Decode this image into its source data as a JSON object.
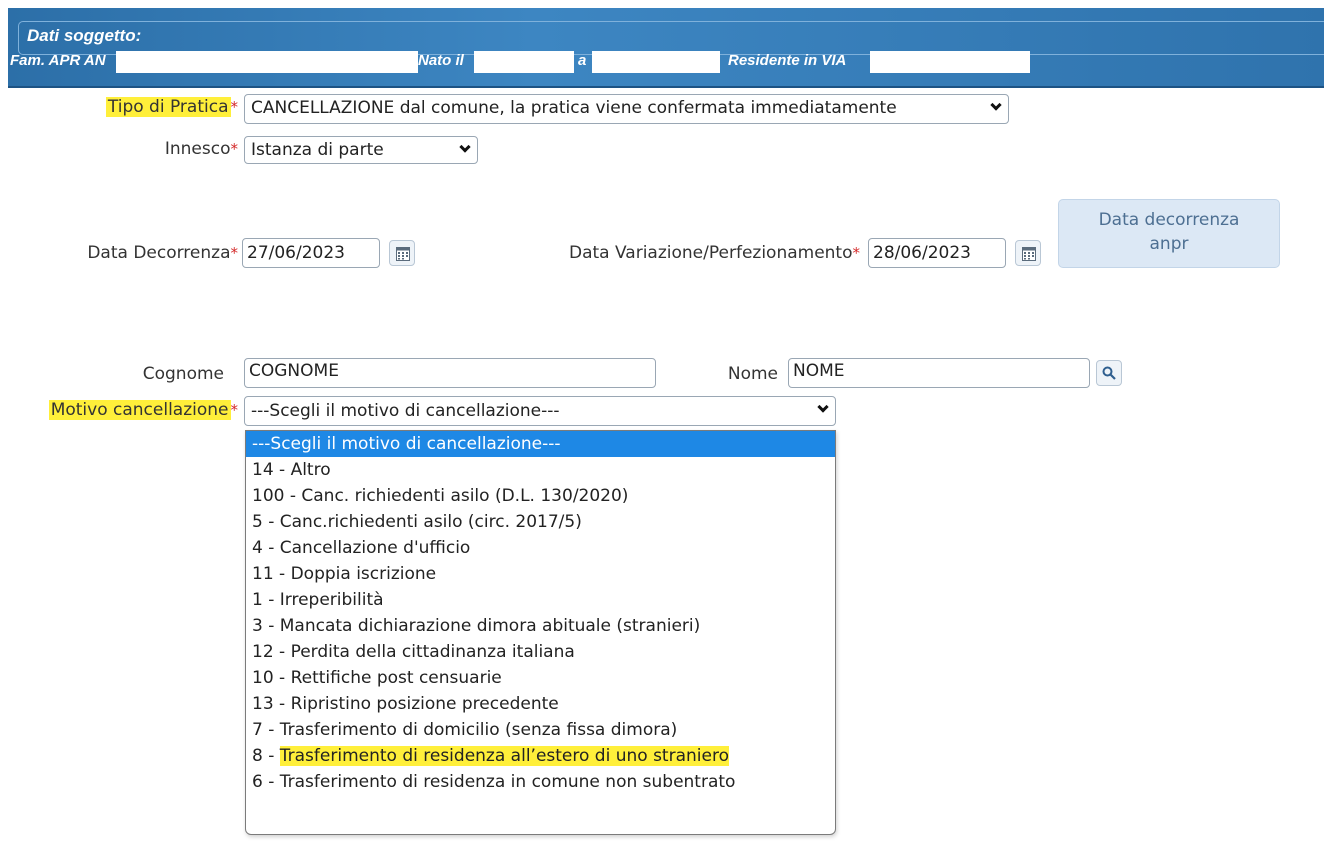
{
  "header": {
    "title": "Dati soggetto:",
    "family_label": "Fam. APR AN",
    "born_label": "Nato il",
    "at_label": "a",
    "residence_label": "Residente in VIA"
  },
  "form": {
    "tipo_pratica": {
      "label": "Tipo di Pratica",
      "required": "*",
      "value": "CANCELLAZIONE dal comune, la pratica viene confermata immediatamente"
    },
    "innesco": {
      "label": "Innesco",
      "required": "*",
      "value": "Istanza di parte"
    },
    "data_decorrenza": {
      "label": "Data Decorrenza",
      "required": "*",
      "value": "27/06/2023"
    },
    "data_variazione": {
      "label": "Data Variazione/Perfezionamento",
      "required": "*",
      "value": "28/06/2023"
    },
    "anpr_button": {
      "line1": "Data decorrenza",
      "line2": "anpr"
    },
    "cognome": {
      "label": "Cognome",
      "value": "COGNOME"
    },
    "nome": {
      "label": "Nome",
      "value": "NOME"
    },
    "motivo": {
      "label": "Motivo cancellazione",
      "required": "*",
      "value": "---Scegli il motivo di cancellazione---"
    }
  },
  "motivo_options": [
    {
      "label": "---Scegli il motivo di cancellazione---"
    },
    {
      "label": "14 - Altro"
    },
    {
      "label": "100 - Canc. richiedenti asilo (D.L. 130/2020)"
    },
    {
      "label": "5 - Canc.richiedenti asilo (circ. 2017/5)"
    },
    {
      "label": "4 - Cancellazione d'ufficio"
    },
    {
      "label": "11 - Doppia iscrizione"
    },
    {
      "label": "1 - Irreperibilità"
    },
    {
      "label": "3 - Mancata dichiarazione dimora abituale (stranieri)"
    },
    {
      "label": "12 - Perdita della cittadinanza italiana"
    },
    {
      "label": "10 - Rettifiche post censuarie"
    },
    {
      "label": "13 - Ripristino posizione precedente"
    },
    {
      "label": "7 - Trasferimento di domicilio (senza fissa dimora)"
    },
    {
      "prefix": "8 - ",
      "highlight": "Trasferimento di residenza all’estero di uno straniero"
    },
    {
      "label": "6 - Trasferimento di residenza in comune non subentrato"
    }
  ],
  "colors": {
    "header_blue": "#3d86c2",
    "highlight_yellow": "#ffef3a",
    "selected_blue": "#1e88e5",
    "required_red": "#d42b2b"
  },
  "icons": {
    "calendar": "calendar-icon",
    "search": "search-icon",
    "dropdown": "chevron-down-icon"
  }
}
